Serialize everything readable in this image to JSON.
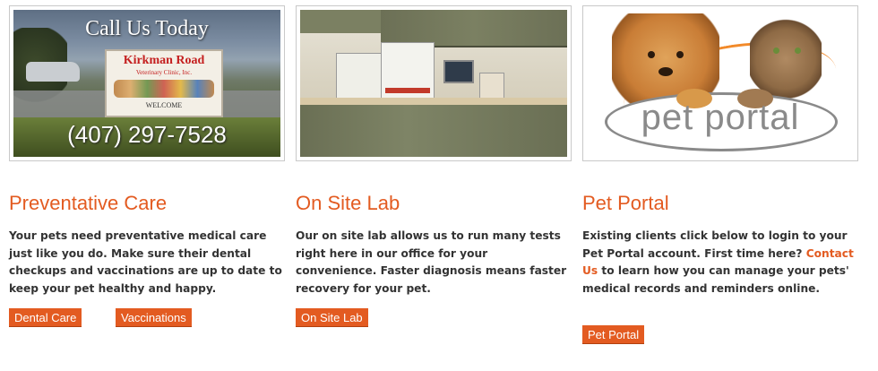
{
  "cards": [
    {
      "photo": {
        "overlay_title": "Call Us Today",
        "overlay_phone": "(407) 297-7528",
        "sign_title": "Kirkman Road",
        "sign_subtitle": "Veterinary Clinic, Inc.",
        "sign_welcome": "WELCOME"
      },
      "heading": "Preventative Care",
      "body": "Your pets need preventative medical care just like you do. Make sure their dental checkups and vaccinations are up to date to keep your pet healthy and happy.",
      "buttons": [
        "Dental Care",
        "Vaccinations"
      ]
    },
    {
      "heading": "On Site Lab",
      "body": "Our on site lab allows us to run many tests right here in our office for your convenience. Faster diagnosis means faster recovery for your pet.",
      "buttons": [
        "On Site Lab"
      ]
    },
    {
      "photo": {
        "logo_text": "pet portal"
      },
      "heading": "Pet Portal",
      "body_before_link": "Existing clients click below to login to your Pet Portal account. First time here? ",
      "body_link": "Contact Us",
      "body_after_link": " to learn how you can manage your pets' medical records and reminders online.",
      "buttons": [
        "Pet Portal"
      ]
    }
  ],
  "colors": {
    "accent": "#e35b21",
    "text": "#333333",
    "frame_border": "#c9c9c9"
  },
  "icons": [
    "clinic-sign-photo",
    "lab-photo",
    "pet-portal-logo"
  ]
}
